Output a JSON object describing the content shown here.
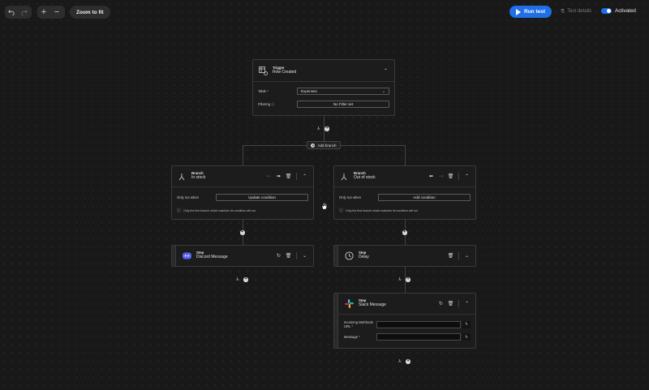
{
  "toolbar": {
    "undo": "undo-icon",
    "redo": "redo-icon",
    "zoom_in": "plus-icon",
    "zoom_out": "minus-icon",
    "zoom_to_fit": "Zoom to fit",
    "run_test": "Run test",
    "test_details": "Test details",
    "activated": "Activated",
    "activated_on": true
  },
  "colors": {
    "accent": "#1f6fe8",
    "background": "#191919",
    "card": "#1c1c1c"
  },
  "trigger": {
    "type": "Trigger",
    "name": "Row Created",
    "table_label": "Table *",
    "table_value": "Expenses",
    "filtering_label": "Filtering",
    "filtering_value": "No Filter set"
  },
  "add_branch": "Add branch",
  "branches": [
    {
      "type": "Branch",
      "name": "In stock",
      "only_run_when": "Only run when",
      "condition_button": "Update condition",
      "note": "Only the first branch which matches its condition will run"
    },
    {
      "type": "Branch",
      "name": "Out of stock",
      "only_run_when": "Only run when",
      "condition_button": "Add condition",
      "note": "Only the first branch which matches its condition will run"
    }
  ],
  "steps": {
    "discord": {
      "type": "Step",
      "name": "Discord Message"
    },
    "delay": {
      "type": "Step",
      "name": "Delay"
    },
    "slack": {
      "type": "Step",
      "name": "Slack Message",
      "webhook_label_1": "Incoming Webhook",
      "webhook_label_2": "URL *",
      "message_label": "Message *",
      "webhook_value": "",
      "message_value": ""
    }
  }
}
